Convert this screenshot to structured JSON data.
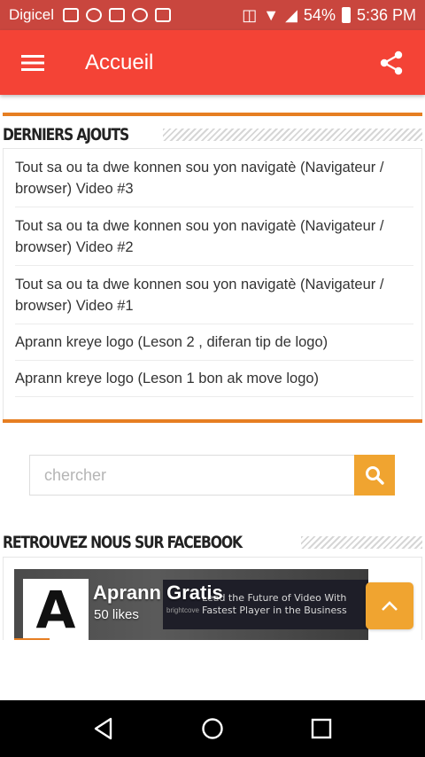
{
  "status_bar": {
    "carrier": "Digicel",
    "battery": "54%",
    "time": "5:36 PM",
    "icons": [
      "gallery-icon",
      "whatsapp-icon",
      "gmail-icon",
      "shield-icon",
      "facebook-icon",
      "vibrate-icon",
      "wifi-icon",
      "signal-icon",
      "battery-icon"
    ]
  },
  "app_bar": {
    "title": "Accueil",
    "menu_icon": "menu-icon",
    "share_icon": "share-icon",
    "color": "#f44336"
  },
  "recent": {
    "heading": "DERNIERS AJOUTS",
    "items": [
      "Tout sa ou ta dwe konnen sou yon navigatè (Navigateur / browser) Video #3",
      "Tout sa ou ta dwe konnen sou yon navigatè (Navigateur / browser) Video #2",
      "Tout sa ou ta dwe konnen sou yon navigatè (Navigateur / browser) Video #1",
      "Aprann kreye logo (Leson 2 , diferan tip de logo)",
      "Aprann kreye logo (Leson 1 bon ak move logo)"
    ]
  },
  "search": {
    "placeholder": "chercher",
    "button_icon": "search-icon",
    "button_color": "#f0a430"
  },
  "facebook": {
    "heading": "RETROUVEZ NOUS SUR FACEBOOK",
    "page_name": "Aprann Gratis",
    "likes": "50 likes",
    "logo_letter": "A",
    "ad_text": "Lead the Future of Video With Fastest Player in the Business",
    "ad_brand": "brightcove"
  },
  "back_to_top_icon": "chevron-up-icon",
  "nav_bar": {
    "buttons": [
      "back-icon",
      "home-icon",
      "recents-icon"
    ]
  },
  "colors": {
    "accent_orange": "#e67e22",
    "status_bar": "#c9463e"
  }
}
